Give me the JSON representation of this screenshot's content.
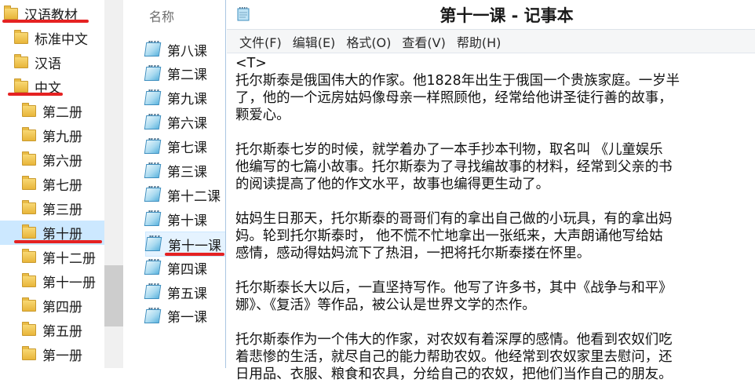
{
  "tree": {
    "items": [
      {
        "label": "汉语教材",
        "indent": 0,
        "selected": false
      },
      {
        "label": "标准中文",
        "indent": 1,
        "selected": false
      },
      {
        "label": "汉语",
        "indent": 1,
        "selected": false
      },
      {
        "label": "中文",
        "indent": 1,
        "selected": false
      },
      {
        "label": "第二册",
        "indent": 2,
        "selected": false
      },
      {
        "label": "第九册",
        "indent": 2,
        "selected": false
      },
      {
        "label": "第六册",
        "indent": 2,
        "selected": false
      },
      {
        "label": "第七册",
        "indent": 2,
        "selected": false
      },
      {
        "label": "第三册",
        "indent": 2,
        "selected": false
      },
      {
        "label": "第十册",
        "indent": 2,
        "selected": true
      },
      {
        "label": "第十二册",
        "indent": 2,
        "selected": false
      },
      {
        "label": "第十一册",
        "indent": 2,
        "selected": false
      },
      {
        "label": "第四册",
        "indent": 2,
        "selected": false
      },
      {
        "label": "第五册",
        "indent": 2,
        "selected": false
      },
      {
        "label": "第一册",
        "indent": 2,
        "selected": false
      }
    ],
    "collapse_glyph": "^"
  },
  "filelist": {
    "column_header": "名称",
    "items": [
      {
        "label": "第八课",
        "selected": false
      },
      {
        "label": "第二课",
        "selected": false
      },
      {
        "label": "第九课",
        "selected": false
      },
      {
        "label": "第六课",
        "selected": false
      },
      {
        "label": "第七课",
        "selected": false
      },
      {
        "label": "第三课",
        "selected": false
      },
      {
        "label": "第十二课",
        "selected": false
      },
      {
        "label": "第十课",
        "selected": false
      },
      {
        "label": "第十一课",
        "selected": true
      },
      {
        "label": "第四课",
        "selected": false
      },
      {
        "label": "第五课",
        "selected": false
      },
      {
        "label": "第一课",
        "selected": false
      }
    ]
  },
  "notepad": {
    "title": "第十一课 - 记事本",
    "menu": [
      "文件(F)",
      "编辑(E)",
      "格式(O)",
      "查看(V)",
      "帮助(H)"
    ],
    "lines": [
      "<T>",
      "托尔斯泰是俄国伟大的作家。他1828年出生于俄国一个贵族家庭。一岁半",
      "了，他的一个远房姑妈像母亲一样照顾他，经常给他讲圣徒行善的故事，",
      "颗爱心。",
      "",
      "托尔斯泰七岁的时候，就学着办了一本手抄本刊物，取名叫 《儿童娱乐",
      "他编写的七篇小故事。托尔斯泰为了寻找编故事的材料，经常到父亲的书",
      "的阅读提高了他的作文水平，故事也编得更生动了。",
      "",
      "姑妈生日那天，托尔斯泰的哥哥们有的拿出自己做的小玩具，有的拿出妈",
      "妈。轮到托尔斯泰时， 他不慌不忙地拿出一张纸来，大声朗诵他写给姑",
      "感情，感动得姑妈流下了热泪，一把将托尔斯泰搂在怀里。",
      "",
      "托尔斯泰长大以后，一直坚持写作。他写了许多书，其中《战争与和平》",
      "娜》、《复活》等作品，被公认是世界文学的杰作。",
      "",
      "托尔斯泰作为一个伟大的作家，对农奴有着深厚的感情。他看到农奴们吃",
      "着悲惨的生活，就尽自己的能力帮助农奴。他经常到农奴家里去慰问，还",
      "日用品、衣服、粮食和农具，分给自己的农奴，把他们当作自己的朋友。"
    ]
  },
  "colors": {
    "selection": "#cce8ff",
    "annotation": "#e52222",
    "folder": "#f2c94c",
    "menubar": "#f5f6f7"
  }
}
